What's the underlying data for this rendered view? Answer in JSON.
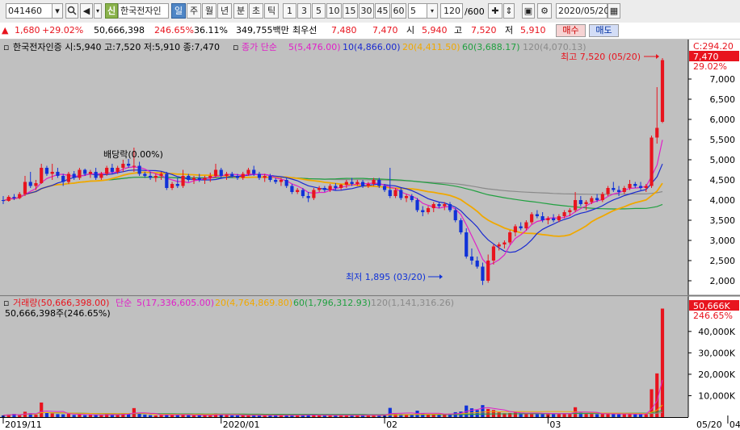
{
  "toolbar": {
    "code": "041460",
    "name_badge": "신",
    "name": "한국전자인",
    "period_tabs": [
      "일",
      "주",
      "월",
      "년",
      "분",
      "초",
      "틱"
    ],
    "interval_buttons": [
      "1",
      "3",
      "5",
      "10",
      "15",
      "30",
      "45",
      "60"
    ],
    "interval_value": "5",
    "count": "120",
    "count_total": "/600",
    "date": "2020/05/20"
  },
  "quote": {
    "change": "1,680",
    "change_pct": "+29.02%",
    "volume": "50,666,398",
    "volume_ratio": "246.65%",
    "turnover": "36.11%",
    "amount": "349,755백만",
    "best_ask_label": "최우선",
    "best_ask": "7,480",
    "best_bid": "7,470",
    "open_label": "시",
    "open": "5,940",
    "high_label": "고",
    "high": "7,520",
    "low_label": "저",
    "low": "5,910",
    "buy_button": "매수",
    "sell_button": "매도"
  },
  "legend": {
    "info": "한국전자인증 시:5,940 고:7,520 저:5,910 종:7,470",
    "ma_label": "종가 단순",
    "ma5": "5(5,476.00)",
    "ma10": "10(4,866.00)",
    "ma20": "20(4,411.50)",
    "ma60": "60(3,688.17)",
    "ma120": "120(4,070.13)"
  },
  "price_annotations": {
    "dividend": "배당락(0.00%)",
    "highest": "최고 7,520 (05/20)",
    "lowest": "최저 1,895 (03/20)",
    "current_badge": "7,470",
    "current_pct": "29.02%",
    "c_label": "C:294.20"
  },
  "volume_legend": {
    "vol": "거래량(50,666,398.00)",
    "ma_label": "단순",
    "ma5": "5(17,336,605.00)",
    "ma20": "20(4,764,869.80)",
    "ma60": "60(1,796,312.93)",
    "ma120": "120(1,141,316.26)",
    "current": "50,666,398주(246.65%)",
    "badge": "50,666K",
    "badge_pct": "246.65%"
  },
  "colors": {
    "up": "#e8141e",
    "down": "#1032d8",
    "ma5": "#e020c8",
    "ma10": "#1a2ad0",
    "ma20": "#f0a800",
    "ma60": "#20a040",
    "ma120": "#8a8a8a",
    "plot_bg": "#c0c0c0"
  },
  "chart_data": {
    "type": "candlestick",
    "price_ticks": [
      2000,
      2500,
      3000,
      3500,
      4000,
      4500,
      5000,
      5500,
      6000,
      6500,
      7000
    ],
    "ylim": [
      1700,
      7700
    ],
    "volume_ticks": [
      "10,000K",
      "20,000K",
      "30,000K",
      "40,000K"
    ],
    "volume_tick_values": [
      10000,
      20000,
      30000,
      40000
    ],
    "volume_ylim": [
      0,
      55000
    ],
    "x_labels": [
      "2019/11",
      "2020/01",
      "02",
      "03",
      "04",
      "05"
    ],
    "x_label_index": [
      0,
      40,
      70,
      100,
      133,
      163
    ],
    "right_date": "05/20",
    "candles": [
      [
        4000,
        4100,
        3900,
        3980
      ],
      [
        3980,
        4120,
        3960,
        4080
      ],
      [
        4080,
        4150,
        4000,
        4050
      ],
      [
        4050,
        4200,
        4020,
        4150
      ],
      [
        4150,
        4600,
        4100,
        4450
      ],
      [
        4450,
        4700,
        4300,
        4350
      ],
      [
        4350,
        4500,
        4250,
        4420
      ],
      [
        4420,
        4900,
        4400,
        4800
      ],
      [
        4800,
        4850,
        4600,
        4650
      ],
      [
        4650,
        4900,
        4500,
        4700
      ],
      [
        4700,
        4800,
        4550,
        4600
      ],
      [
        4600,
        4650,
        4350,
        4450
      ],
      [
        4450,
        4700,
        4400,
        4650
      ],
      [
        4650,
        4720,
        4500,
        4550
      ],
      [
        4550,
        4800,
        4500,
        4750
      ],
      [
        4750,
        4780,
        4600,
        4650
      ],
      [
        4650,
        4750,
        4550,
        4700
      ],
      [
        4700,
        4800,
        4500,
        4550
      ],
      [
        4550,
        4700,
        4500,
        4650
      ],
      [
        4650,
        4850,
        4600,
        4800
      ],
      [
        4800,
        4900,
        4650,
        4700
      ],
      [
        4700,
        4850,
        4650,
        4800
      ],
      [
        4800,
        5000,
        4700,
        4900
      ],
      [
        4900,
        5020,
        4800,
        4850
      ],
      [
        4850,
        5300,
        4700,
        4850
      ],
      [
        4850,
        4950,
        4600,
        4650
      ],
      [
        4650,
        4700,
        4550,
        4600
      ],
      [
        4600,
        4700,
        4500,
        4550
      ],
      [
        4550,
        4650,
        4450,
        4600
      ],
      [
        4600,
        4700,
        4500,
        4650
      ],
      [
        4650,
        4700,
        4250,
        4300
      ],
      [
        4300,
        4450,
        4250,
        4400
      ],
      [
        4400,
        4550,
        4300,
        4350
      ],
      [
        4350,
        4750,
        4300,
        4600
      ],
      [
        4600,
        4650,
        4450,
        4500
      ],
      [
        4500,
        4600,
        4400,
        4550
      ],
      [
        4550,
        4650,
        4450,
        4500
      ],
      [
        4500,
        4600,
        4400,
        4550
      ],
      [
        4550,
        4680,
        4450,
        4600
      ],
      [
        4600,
        4900,
        4550,
        4750
      ],
      [
        4750,
        4800,
        4550,
        4600
      ],
      [
        4600,
        4700,
        4500,
        4650
      ],
      [
        4650,
        4700,
        4550,
        4600
      ],
      [
        4600,
        4650,
        4500,
        4550
      ],
      [
        4550,
        4700,
        4500,
        4650
      ],
      [
        4650,
        4800,
        4600,
        4750
      ],
      [
        4750,
        4850,
        4600,
        4650
      ],
      [
        4650,
        4700,
        4500,
        4550
      ],
      [
        4550,
        4650,
        4450,
        4600
      ],
      [
        4600,
        4650,
        4450,
        4500
      ],
      [
        4500,
        4550,
        4400,
        4450
      ],
      [
        4450,
        4550,
        4350,
        4500
      ],
      [
        4500,
        4550,
        4300,
        4350
      ],
      [
        4350,
        4400,
        4150,
        4200
      ],
      [
        4200,
        4300,
        4150,
        4250
      ],
      [
        4250,
        4300,
        4050,
        4100
      ],
      [
        4100,
        4200,
        3950,
        4050
      ],
      [
        4050,
        4300,
        4000,
        4250
      ],
      [
        4250,
        4350,
        4200,
        4300
      ],
      [
        4300,
        4350,
        4200,
        4250
      ],
      [
        4250,
        4400,
        4200,
        4350
      ],
      [
        4350,
        4420,
        4250,
        4300
      ],
      [
        4300,
        4400,
        4250,
        4380
      ],
      [
        4380,
        4500,
        4300,
        4450
      ],
      [
        4450,
        4550,
        4350,
        4400
      ],
      [
        4400,
        4500,
        4350,
        4450
      ],
      [
        4450,
        4500,
        4300,
        4350
      ],
      [
        4350,
        4450,
        4300,
        4400
      ],
      [
        4400,
        4550,
        4350,
        4500
      ],
      [
        4500,
        4550,
        4300,
        4350
      ],
      [
        4350,
        4400,
        4200,
        4250
      ],
      [
        4250,
        4800,
        4050,
        4100
      ],
      [
        4100,
        4300,
        4050,
        4250
      ],
      [
        4250,
        4300,
        4000,
        4050
      ],
      [
        4050,
        4150,
        3950,
        4100
      ],
      [
        4100,
        4150,
        3950,
        4000
      ],
      [
        4000,
        4050,
        3700,
        3750
      ],
      [
        3750,
        3850,
        3600,
        3700
      ],
      [
        3700,
        3850,
        3650,
        3800
      ],
      [
        3800,
        3950,
        3700,
        3900
      ],
      [
        3900,
        3950,
        3800,
        3850
      ],
      [
        3850,
        3950,
        3750,
        3900
      ],
      [
        3900,
        3950,
        3700,
        3750
      ],
      [
        3750,
        3800,
        3450,
        3500
      ],
      [
        3500,
        3550,
        3150,
        3200
      ],
      [
        3200,
        3300,
        2550,
        2600
      ],
      [
        2600,
        2800,
        2400,
        2500
      ],
      [
        2500,
        2600,
        2300,
        2350
      ],
      [
        2350,
        2450,
        1895,
        2000
      ],
      [
        2000,
        2650,
        1950,
        2500
      ],
      [
        2500,
        2900,
        2400,
        2850
      ],
      [
        2850,
        2950,
        2750,
        2900
      ],
      [
        2900,
        3000,
        2800,
        2950
      ],
      [
        2950,
        3250,
        2900,
        3200
      ],
      [
        3200,
        3400,
        3100,
        3350
      ],
      [
        3350,
        3450,
        3250,
        3300
      ],
      [
        3300,
        3500,
        3250,
        3450
      ],
      [
        3450,
        3700,
        3400,
        3650
      ],
      [
        3650,
        3750,
        3550,
        3600
      ],
      [
        3600,
        3700,
        3450,
        3500
      ],
      [
        3500,
        3600,
        3400,
        3550
      ],
      [
        3550,
        3650,
        3450,
        3500
      ],
      [
        3500,
        3650,
        3450,
        3600
      ],
      [
        3600,
        3750,
        3550,
        3700
      ],
      [
        3700,
        3800,
        3600,
        3750
      ],
      [
        3750,
        4200,
        3700,
        4000
      ],
      [
        4000,
        4100,
        3850,
        3900
      ],
      [
        3900,
        4000,
        3750,
        3950
      ],
      [
        3950,
        4100,
        3900,
        4050
      ],
      [
        4050,
        4150,
        3950,
        4000
      ],
      [
        4000,
        4200,
        3950,
        4150
      ],
      [
        4150,
        4350,
        4100,
        4300
      ],
      [
        4300,
        4450,
        4200,
        4250
      ],
      [
        4250,
        4350,
        4100,
        4200
      ],
      [
        4200,
        4350,
        4150,
        4300
      ],
      [
        4300,
        4500,
        4250,
        4400
      ],
      [
        4400,
        4450,
        4300,
        4350
      ],
      [
        4350,
        4450,
        4250,
        4300
      ],
      [
        4300,
        4400,
        4200,
        4350
      ],
      [
        4350,
        5600,
        4300,
        5550
      ],
      [
        5550,
        6800,
        5400,
        5790
      ],
      [
        5940,
        7520,
        5910,
        7470
      ]
    ],
    "volumes": [
      800,
      1200,
      1500,
      900,
      2500,
      1800,
      1100,
      6800,
      2000,
      1700,
      1400,
      1300,
      1600,
      1000,
      1200,
      900,
      1100,
      1000,
      900,
      1500,
      1100,
      1000,
      1800,
      1300,
      4200,
      1500,
      1100,
      900,
      800,
      900,
      1400,
      1000,
      900,
      1300,
      900,
      800,
      900,
      800,
      1000,
      1700,
      1100,
      900,
      800,
      800,
      900,
      1000,
      900,
      800,
      700,
      800,
      900,
      800,
      900,
      1000,
      800,
      900,
      1100,
      1000,
      800,
      800,
      900,
      800,
      800,
      900,
      800,
      800,
      800,
      900,
      1000,
      900,
      1000,
      4300,
      1500,
      1400,
      1200,
      1300,
      3000,
      1800,
      1500,
      1300,
      1200,
      1300,
      1600,
      2300,
      2600,
      5400,
      4100,
      3300,
      5600,
      3800,
      3300,
      2200,
      1800,
      1900,
      2100,
      1800,
      1700,
      2000,
      1800,
      1600,
      1500,
      1400,
      1600,
      1800,
      1700,
      4600,
      2000,
      1600,
      1500,
      1400,
      1500,
      1700,
      1500,
      1300,
      1300,
      1600,
      1400,
      1300,
      1300,
      13000,
      20400,
      50666
    ]
  }
}
